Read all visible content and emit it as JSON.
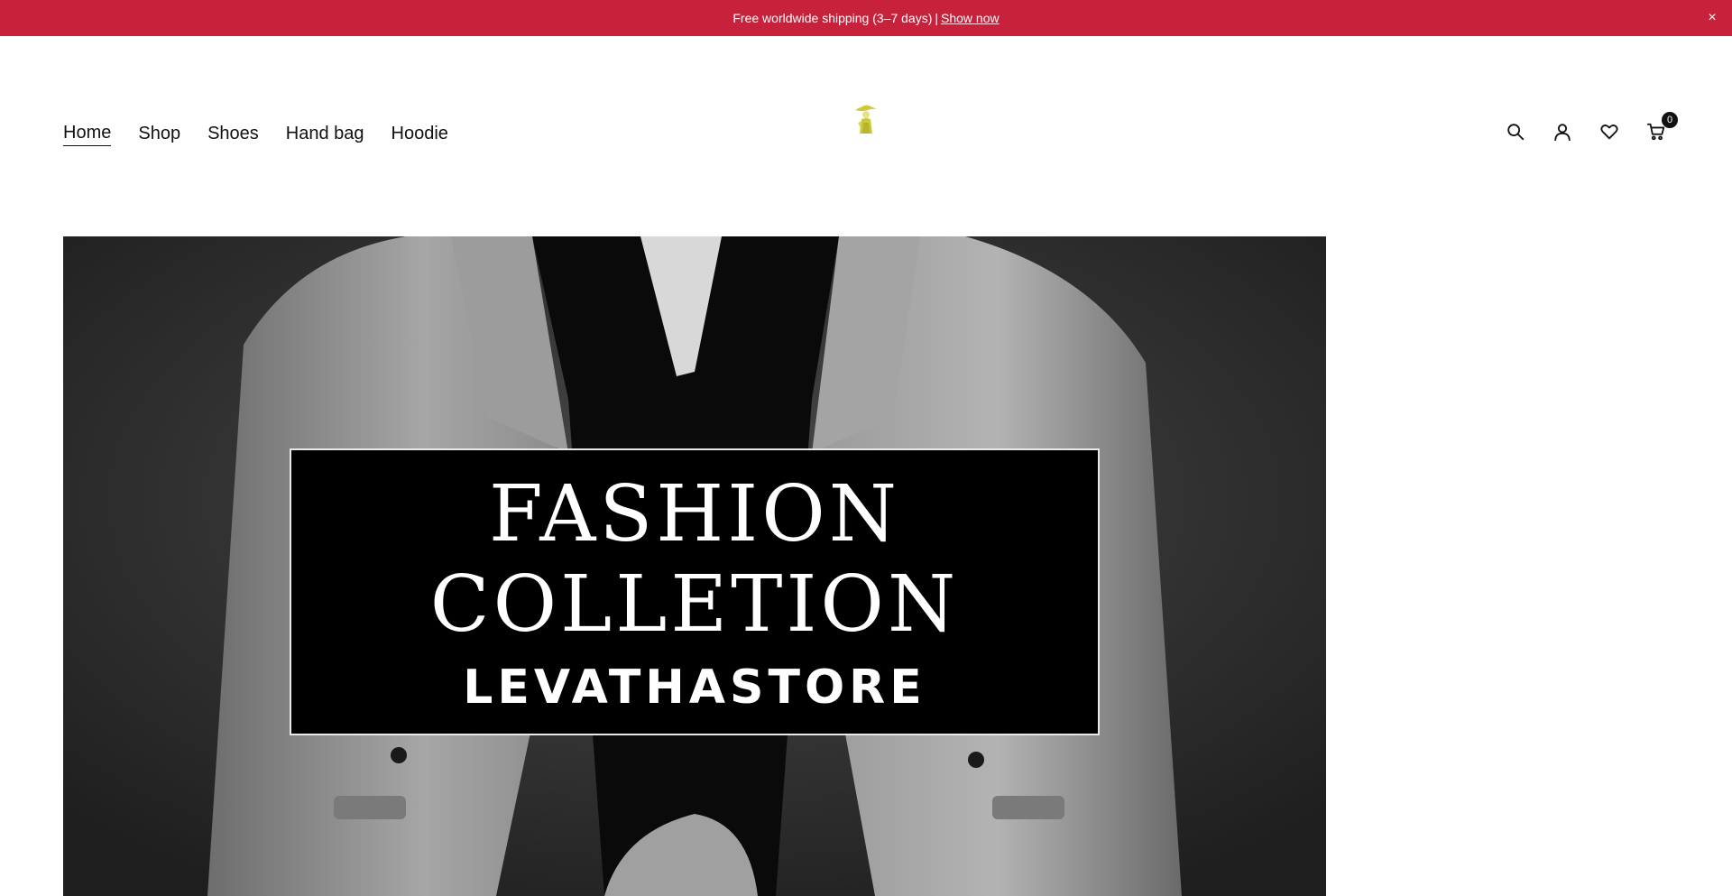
{
  "announcement": {
    "text": "Free worldwide shipping (3–7 days)",
    "separator": "|",
    "link_label": "Show now",
    "close_symbol": "×",
    "background_color": "#c8213b"
  },
  "nav": {
    "items": [
      {
        "label": "Home",
        "active": true
      },
      {
        "label": "Shop"
      },
      {
        "label": "Shoes"
      },
      {
        "label": "Hand bag"
      },
      {
        "label": "Hoodie"
      }
    ]
  },
  "logo": {
    "icon": "woman-figure-logo-icon",
    "color": "#c9c93a"
  },
  "header_icons": {
    "search": "search-icon",
    "account": "user-icon",
    "wishlist": "heart-icon",
    "cart": "cart-icon",
    "cart_count": "0"
  },
  "hero": {
    "line1": "FASHION",
    "line2": "COLLETION",
    "line3": "LEVATHASTORE"
  }
}
